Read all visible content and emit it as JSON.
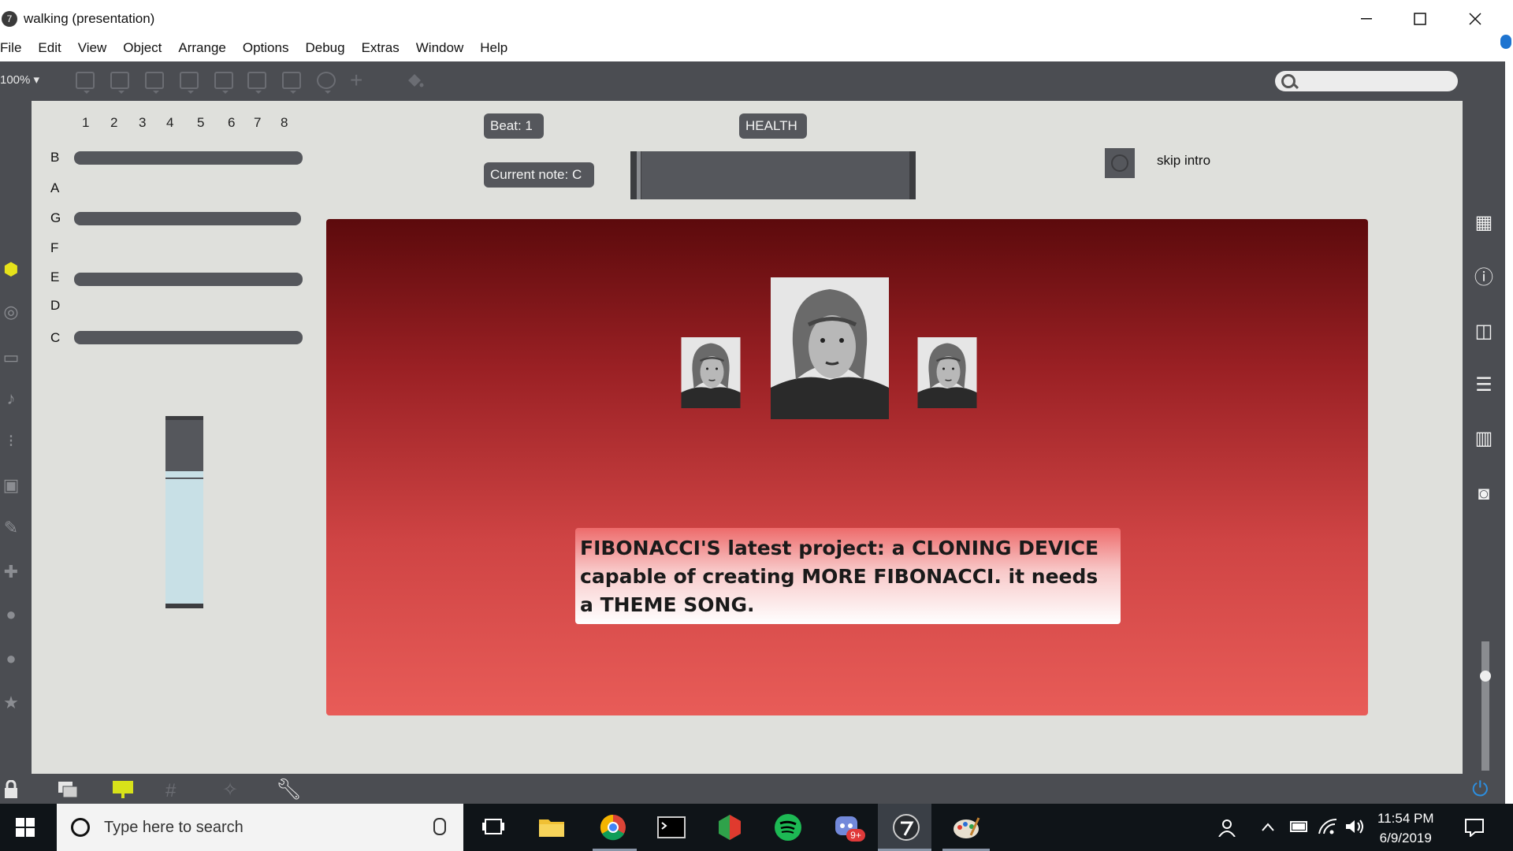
{
  "window": {
    "title": "walking (presentation)"
  },
  "menu": [
    "File",
    "Edit",
    "View",
    "Object",
    "Arrange",
    "Options",
    "Debug",
    "Extras",
    "Window",
    "Help"
  ],
  "toolbar": {
    "zoom": "100% ▾"
  },
  "patch": {
    "step_numbers": [
      "1",
      "2",
      "3",
      "4",
      "5",
      "6",
      "7",
      "8"
    ],
    "notes": [
      "B",
      "A",
      "G",
      "F",
      "E",
      "D",
      "C"
    ],
    "beat_label": "Beat: 1",
    "health_label": "HEALTH",
    "current_note_label": "Current note: C",
    "skip_intro_label": "skip intro",
    "caption": "FIBONACCI'S latest project: a CLONING DEVICE capable of creating MORE FIBONACCI. it needs a THEME SONG."
  },
  "taskbar": {
    "search_placeholder": "Type here to search",
    "time": "11:54 PM",
    "date": "6/9/2019",
    "discord_badge": "9+"
  },
  "colors": {
    "canvas_bg": "#dfe0dc",
    "ui_dark": "#4b4d52",
    "element_gray": "#55575c",
    "stage_top": "#5c0a0c",
    "stage_bottom": "#e85c58",
    "accent_blue": "#1e74d0",
    "taskbar": "#0f1418"
  }
}
